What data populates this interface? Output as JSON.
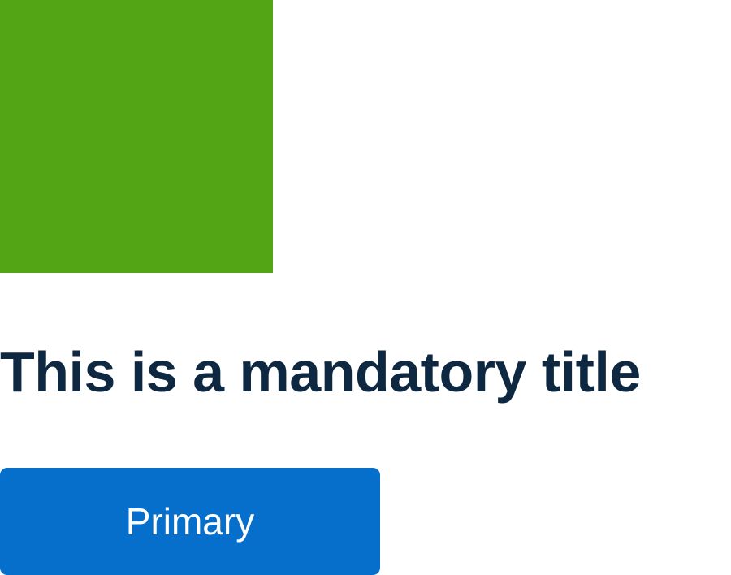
{
  "colors": {
    "image_block": "#54a516",
    "title_text": "#0d2840",
    "primary_button_bg": "#066fcb",
    "primary_button_text": "#ffffff"
  },
  "title": "This is a mandatory title",
  "primary_button": {
    "label": "Primary"
  }
}
